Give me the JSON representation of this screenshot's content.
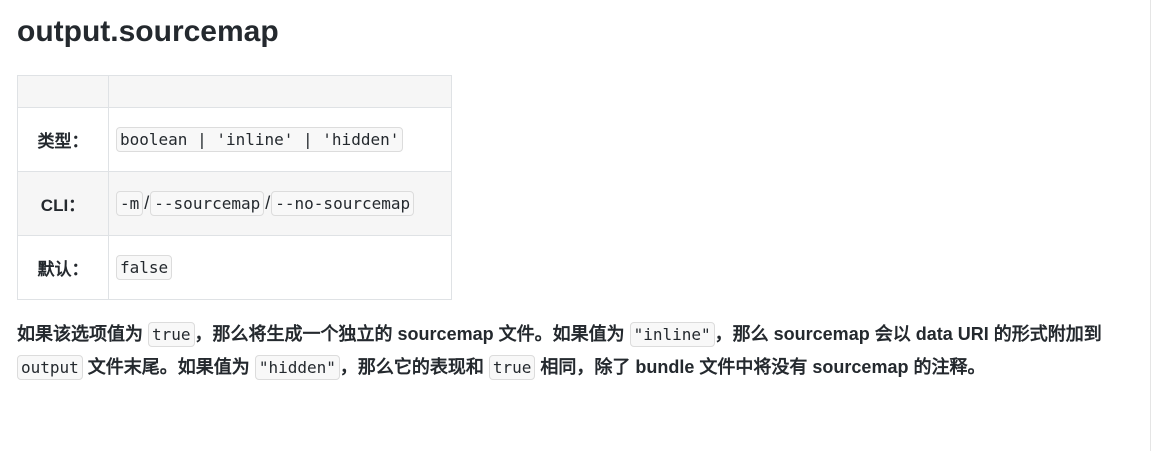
{
  "title": "output.sourcemap",
  "table": {
    "header": [
      "",
      ""
    ],
    "rows": [
      {
        "label": "类型：",
        "code": [
          "boolean | 'inline' | 'hidden'"
        ]
      },
      {
        "label": "CLI：",
        "code": [
          "-m",
          "--sourcemap",
          "--no-sourcemap"
        ],
        "separator": "/"
      },
      {
        "label": "默认：",
        "code": [
          "false"
        ]
      }
    ]
  },
  "description": {
    "line1_a": "如果该选项值为 ",
    "code_true": "true",
    "line1_b": "，那么将生成一个独立的 sourcemap 文件。如果值为 ",
    "code_inline": "\"inline\"",
    "line1_c": "，那么 sourcemap 会以 data URI 的形式附加到 ",
    "code_output": "output",
    "line1_d": " 文件末尾。如果值为 ",
    "code_hidden": "\"hidden\"",
    "line1_e": "，那么它的表现和 ",
    "code_true2": "true",
    "line1_f": " 相同，除了 bundle 文件中将没有 sourcemap 的注释。"
  }
}
